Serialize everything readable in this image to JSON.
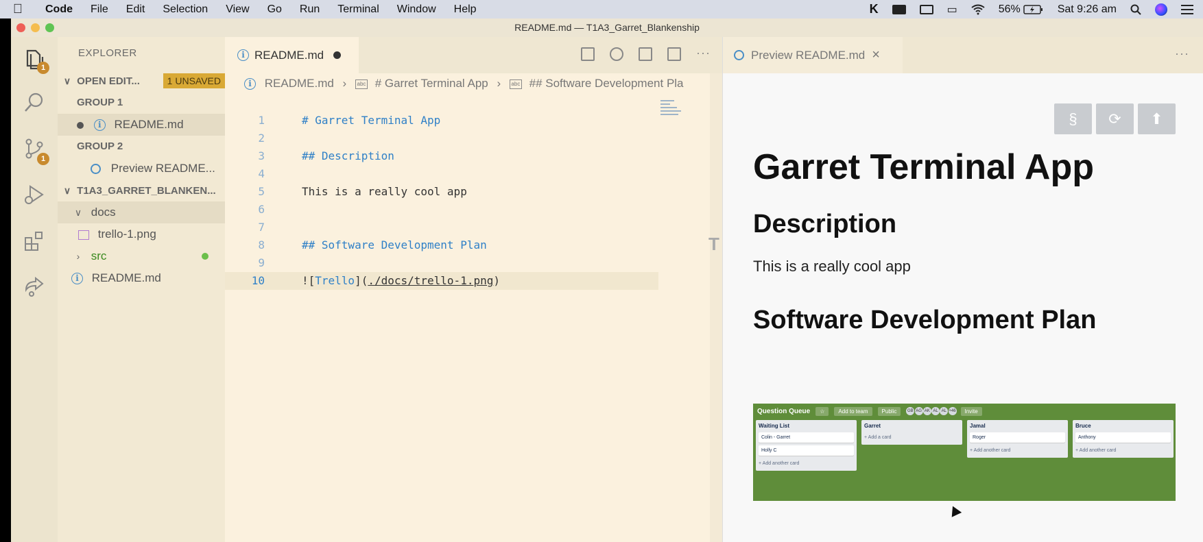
{
  "menubar": {
    "app": "Code",
    "items": [
      "File",
      "Edit",
      "Selection",
      "View",
      "Go",
      "Run",
      "Terminal",
      "Window",
      "Help"
    ],
    "battery": "56%",
    "clock": "Sat 9:26 am",
    "icons": [
      "apple-icon",
      "keyboard-k-icon",
      "window-icon",
      "screen-mirror-icon",
      "airplay-icon",
      "wifi-icon",
      "battery-icon",
      "search-icon",
      "siri-icon",
      "menu-list-icon"
    ]
  },
  "window": {
    "title": "README.md — T1A3_Garret_Blankenship"
  },
  "activitybar": {
    "explorer_badge": "1",
    "scm_badge": "1"
  },
  "sidebar": {
    "title": "EXPLORER",
    "open_editors": "OPEN EDIT...",
    "unsaved_badge": "1 UNSAVED",
    "group1": "GROUP 1",
    "group1_file": "README.md",
    "group2": "GROUP 2",
    "group2_file": "Preview README...",
    "project": "T1A3_GARRET_BLANKEN...",
    "folder_docs": "docs",
    "file_trello": "trello-1.png",
    "folder_src": "src",
    "file_readme": "README.md"
  },
  "editor": {
    "tab_label": "README.md",
    "breadcrumb": [
      "README.md",
      "# Garret Terminal App",
      "## Software Development Pla"
    ],
    "lines": [
      {
        "n": "1",
        "text": "# Garret Terminal App"
      },
      {
        "n": "2",
        "text": ""
      },
      {
        "n": "3",
        "text": "## Description"
      },
      {
        "n": "4",
        "text": ""
      },
      {
        "n": "5",
        "text": "This is a really cool app"
      },
      {
        "n": "6",
        "text": ""
      },
      {
        "n": "7",
        "text": ""
      },
      {
        "n": "8",
        "text": "## Software Development Plan"
      },
      {
        "n": "9",
        "text": ""
      },
      {
        "n": "10",
        "text": "![Trello](./docs/trello-1.png)"
      }
    ],
    "line10_parts": {
      "bang": "![",
      "alt": "Trello",
      "mid": "](",
      "path": "./docs/trello-1.png",
      "end": ")"
    }
  },
  "preview": {
    "tab_label": "Preview README.md",
    "buttons": [
      "§",
      "⟳",
      "⬆"
    ],
    "h1": "Garret Terminal App",
    "h2_description": "Description",
    "paragraph": "This is a really cool app",
    "h2_plan": "Software Development Plan",
    "trello": {
      "board": "Question Queue",
      "add_to_team": "Add to team",
      "public": "Public",
      "avatars": [
        "GB",
        "AG",
        "AK",
        "AL",
        "AL",
        "+46"
      ],
      "invite": "Invite",
      "lists": [
        {
          "title": "Waiting List",
          "cards": [
            "Colin - Garret",
            "Holly C"
          ],
          "add": "Add another card"
        },
        {
          "title": "Garret",
          "cards": [],
          "add": "Add a card"
        },
        {
          "title": "Jamal",
          "cards": [
            "Roger"
          ],
          "add": "Add another card"
        },
        {
          "title": "Bruce",
          "cards": [
            "Anthony"
          ],
          "add": "Add another card"
        }
      ]
    }
  }
}
